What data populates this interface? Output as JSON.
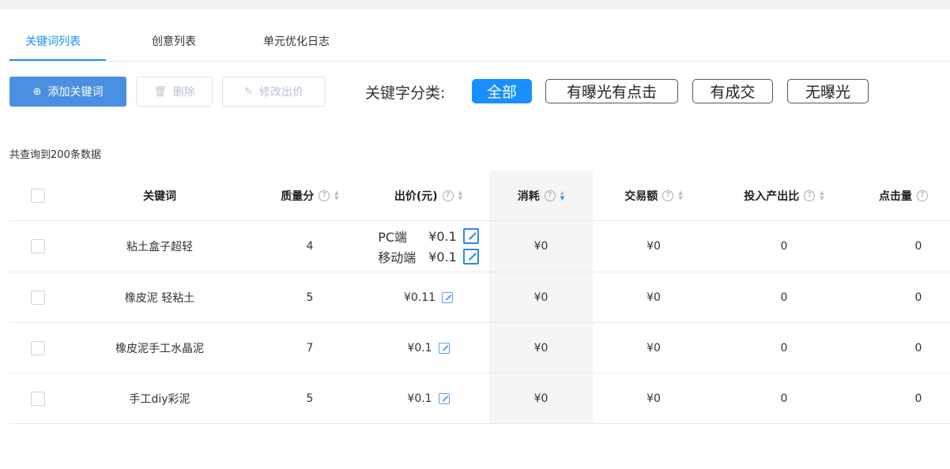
{
  "tabs": [
    "关键词列表",
    "创意列表",
    "单元优化日志"
  ],
  "toolbar": {
    "add_label": "添加关键词",
    "delete_label": "删除",
    "edit_price_label": "修改出价",
    "filter_label": "关键字分类:",
    "filters": [
      "全部",
      "有曝光有点击",
      "有成交",
      "无曝光"
    ]
  },
  "count_text": "共查询到200条数据",
  "table": {
    "headers": [
      "关键词",
      "质量分",
      "出价(元)",
      "消耗",
      "交易额",
      "投入产出比",
      "点击量"
    ],
    "rows": [
      {
        "keyword": "粘土盒子超轻",
        "score": "4",
        "pc_label": "PC端",
        "pc_price": "¥0.1",
        "mobile_label": "移动端",
        "mobile_price": "¥0.1",
        "cost": "¥0",
        "sales": "¥0",
        "roi": "0",
        "clicks": "0"
      },
      {
        "keyword": "橡皮泥 轻粘土",
        "score": "5",
        "price": "¥0.11",
        "cost": "¥0",
        "sales": "¥0",
        "roi": "0",
        "clicks": "0"
      },
      {
        "keyword": "橡皮泥手工水晶泥",
        "score": "7",
        "price": "¥0.1",
        "cost": "¥0",
        "sales": "¥0",
        "roi": "0",
        "clicks": "0"
      },
      {
        "keyword": "手工diy彩泥",
        "score": "5",
        "price": "¥0.1",
        "cost": "¥0",
        "sales": "¥0",
        "roi": "0",
        "clicks": "0"
      }
    ]
  },
  "icons": {
    "add": "plus-circle-icon",
    "delete": "trash-icon",
    "edit": "pencil-icon",
    "help": "question-circle-icon",
    "sort": "sort-caret-icon"
  },
  "colors": {
    "accent": "#1890ff",
    "primary_button": "#4a90e2"
  }
}
